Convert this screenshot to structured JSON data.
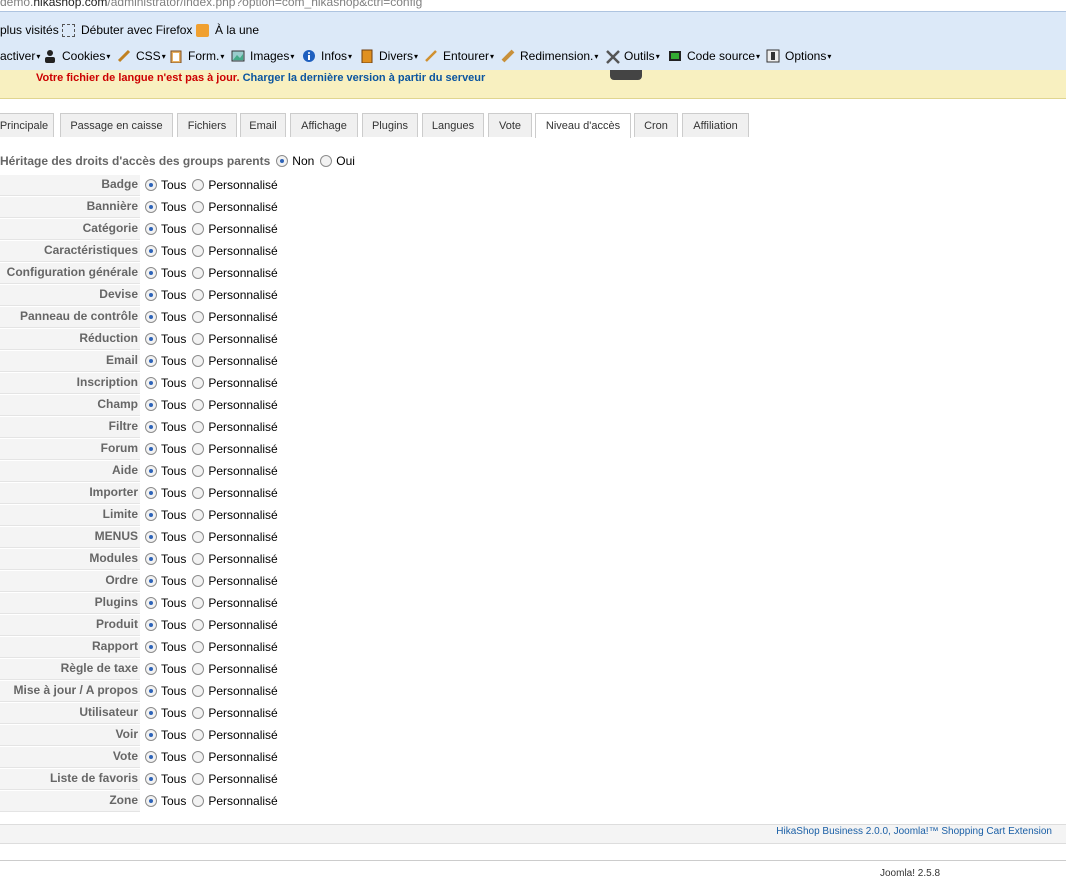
{
  "browser": {
    "url_prefix": "demo.",
    "url_domain": "hikashop.com",
    "url_rest": "/administrator/index.php?option=com_hikashop&ctrl=config"
  },
  "bookmarks": [
    {
      "label": "plus visités",
      "icon": "none"
    },
    {
      "label": "Débuter avec Firefox",
      "icon": "dashed-square-icon"
    },
    {
      "label": "À la une",
      "icon": "rss-icon"
    }
  ],
  "toolbar": [
    {
      "label": "activer",
      "icon": "none"
    },
    {
      "label": "Cookies",
      "icon": "person-icon"
    },
    {
      "label": "CSS",
      "icon": "pencil-icon"
    },
    {
      "label": "Form.",
      "icon": "clipboard-icon"
    },
    {
      "label": "Images",
      "icon": "image-icon"
    },
    {
      "label": "Infos",
      "icon": "info-icon"
    },
    {
      "label": "Divers",
      "icon": "book-icon"
    },
    {
      "label": "Entourer",
      "icon": "pen-icon"
    },
    {
      "label": "Redimension.",
      "icon": "ruler-icon"
    },
    {
      "label": "Outils",
      "icon": "tools-icon"
    },
    {
      "label": "Code source",
      "icon": "terminal-icon"
    },
    {
      "label": "Options",
      "icon": "options-icon"
    }
  ],
  "notice": {
    "message": "Votre fichier de langue n'est pas à jour.",
    "link": "Charger la dernière version à partir du serveur"
  },
  "tabs": [
    {
      "label": "Principale",
      "active": false
    },
    {
      "label": "Passage en caisse",
      "active": false
    },
    {
      "label": "Fichiers",
      "active": false
    },
    {
      "label": "Email",
      "active": false
    },
    {
      "label": "Affichage",
      "active": false
    },
    {
      "label": "Plugins",
      "active": false
    },
    {
      "label": "Langues",
      "active": false
    },
    {
      "label": "Vote",
      "active": false
    },
    {
      "label": "Niveau d'accès",
      "active": true
    },
    {
      "label": "Cron",
      "active": false
    },
    {
      "label": "Affiliation",
      "active": false
    }
  ],
  "inherit": {
    "label": "Héritage des droits d'accès des groups parents",
    "options": [
      {
        "label": "Non",
        "checked": true
      },
      {
        "label": "Oui",
        "checked": false
      }
    ]
  },
  "option_all": "Tous",
  "option_custom": "Personnalisé",
  "access_rows": [
    "Badge",
    "Bannière",
    "Catégorie",
    "Caractéristiques",
    "Configuration générale",
    "Devise",
    "Panneau de contrôle",
    "Réduction",
    "Email",
    "Inscription",
    "Champ",
    "Filtre",
    "Forum",
    "Aide",
    "Importer",
    "Limite",
    "MENUS",
    "Modules",
    "Ordre",
    "Plugins",
    "Produit",
    "Rapport",
    "Règle de taxe",
    "Mise à jour / A propos",
    "Utilisateur",
    "Voir",
    "Vote",
    "Liste de favoris",
    "Zone"
  ],
  "footer": {
    "credit": "HikaShop Business 2.0.0, Joomla!™ Shopping Cart Extension",
    "version": "Joomla! 2.5.8"
  },
  "colors": {
    "toolbar_bg": "#dce9f8",
    "notice_bg": "#f8f0c0",
    "notice_text": "#cc0000",
    "link": "#0b55a0",
    "radio_dot": "#2d63b8"
  }
}
